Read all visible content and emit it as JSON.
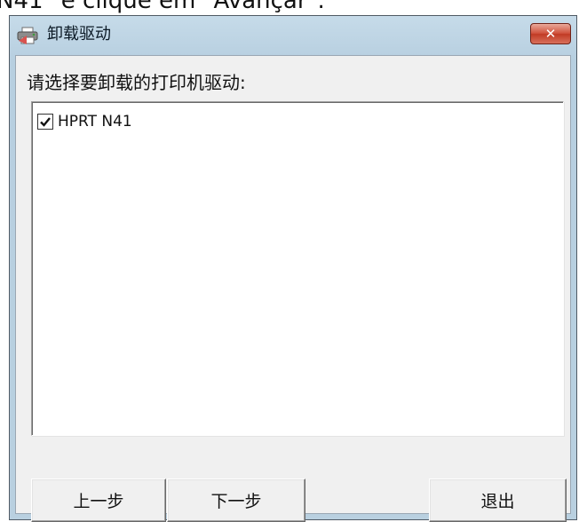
{
  "page_caption": "N41\" e clique em \"Avançar\".",
  "window": {
    "title": "卸载驱动",
    "close_glyph": "✕",
    "title_icon": "printer-icon"
  },
  "prompt": "请选择要卸载的打印机驱动:",
  "drivers": [
    {
      "label": "HPRT N41",
      "checked": true
    }
  ],
  "buttons": {
    "prev": "上一步",
    "next": "下一步",
    "exit": "退出"
  },
  "colors": {
    "close_red": "#c13a24",
    "frame_blue": "#b9d0e0",
    "client_gray": "#f0f0f0"
  }
}
